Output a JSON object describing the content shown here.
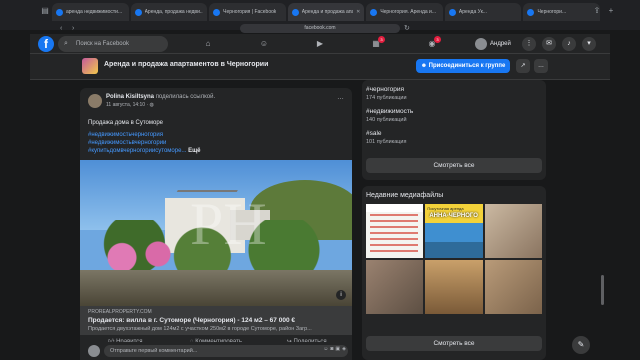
{
  "browser": {
    "url": "facebook.com",
    "tabs": [
      {
        "title": "аренда недвижимости..."
      },
      {
        "title": "Аренда, продажа недви..."
      },
      {
        "title": "Черногория | Facebook"
      },
      {
        "title": "Аренда и продажа апа..."
      },
      {
        "title": "Черногория. Аренда и..."
      },
      {
        "title": "Аренда Ук..."
      },
      {
        "title": "Черногори..."
      }
    ]
  },
  "header": {
    "logo": "f",
    "search_placeholder": "Поиск на Facebook",
    "badges": {
      "marketplace": "3",
      "groups": "3"
    },
    "user_name": "Андрей"
  },
  "group": {
    "title": "Аренда и продажа апартаментов в Черногории",
    "join_label": "Присоединиться к группе"
  },
  "post": {
    "author": "Polina Kisiltsyna",
    "action": "поделилась ссылкой.",
    "date": "11 августа, 14:10 · ",
    "text": "Продажа дома в  Сутоморе",
    "tags": [
      "#недвижимостьчерногория",
      "#недвижимостьвчерногории",
      "#купитьдомвчерногориисутоморе..."
    ],
    "more": "Ещё",
    "watermark": "PH",
    "link": {
      "domain": "PROREALPROPERTY.COM",
      "title": "Продается: вилла в г. Сутоморе (Черногория) - 124 м2 – 67 000 €",
      "desc": "Продается двухэтажный дом 124м2 с участком 250м2 в городе Сутоморе, район Загр..."
    },
    "actions": {
      "like": "Нравится",
      "comment": "Комментировать",
      "share": "Поделиться"
    },
    "comment_placeholder": "Отправьте первый комментарий..."
  },
  "sidebar": {
    "hashtags": [
      {
        "tag": "#черногория",
        "count": "174 публикации"
      },
      {
        "tag": "#недвижимость",
        "count": "140 публикаций"
      },
      {
        "tag": "#sale",
        "count": "101 публикация"
      }
    ],
    "see_all": "Смотреть все",
    "media_title": "Недавние медиафайлы",
    "media_caption": "АННА-ЧЕРНОГО",
    "media_small": "Посуточная аренда",
    "see_all_2": "Смотреть все"
  }
}
